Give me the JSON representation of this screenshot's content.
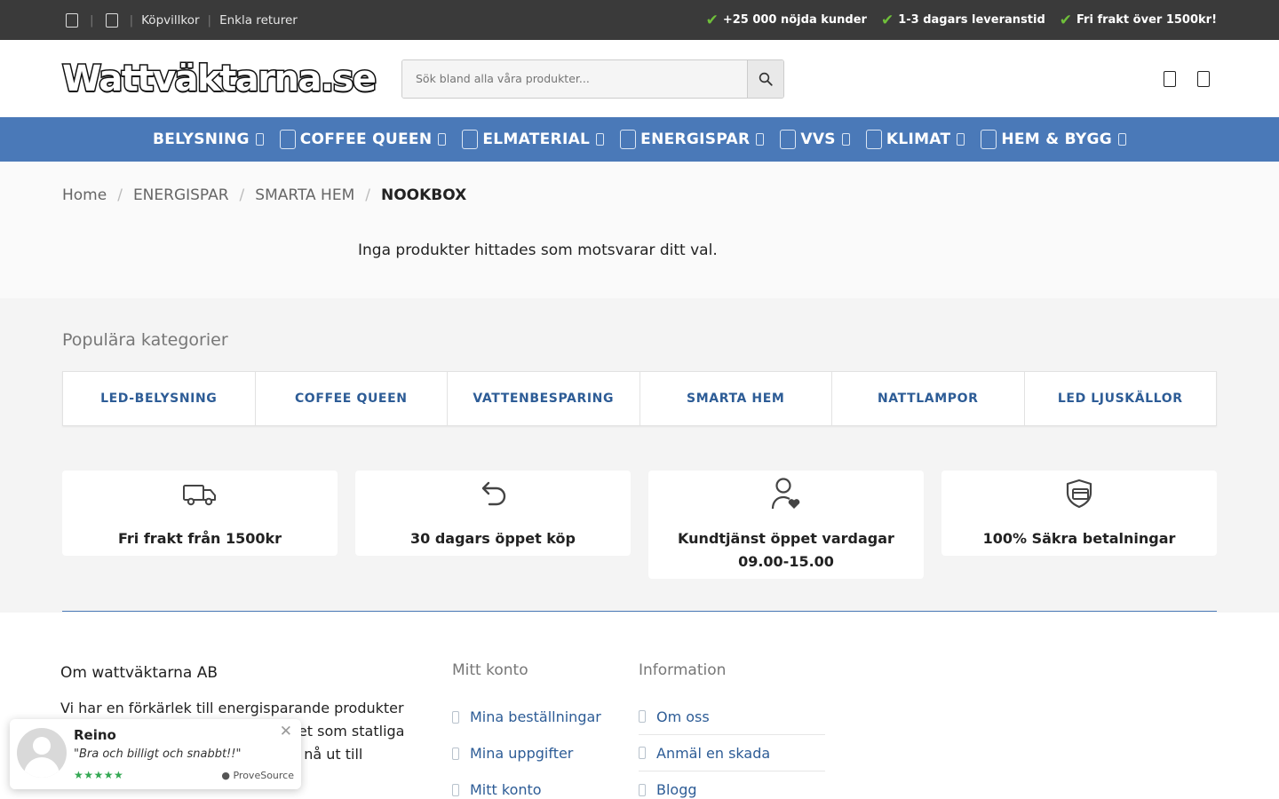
{
  "topbar": {
    "links": [
      "Köpvillkor",
      "Enkla returer"
    ],
    "usps": [
      "+25 000 nöjda kunder",
      "1-3 dagars leveranstid",
      "Fri frakt över 1500kr!"
    ]
  },
  "header": {
    "logo": "Wattväktarna.se",
    "search_placeholder": "Sök bland alla våra produkter..."
  },
  "nav": [
    {
      "label": "BELYSNING",
      "icon": "lamp-icon"
    },
    {
      "label": "COFFEE QUEEN",
      "icon": "coffee-machine-icon"
    },
    {
      "label": "ELMATERIAL",
      "icon": "plug-icon"
    },
    {
      "label": "ENERGISPAR",
      "icon": "energy-icon"
    },
    {
      "label": "VVS",
      "icon": "faucet-icon"
    },
    {
      "label": "KLIMAT",
      "icon": "radiator-icon"
    },
    {
      "label": "HEM & BYGG",
      "icon": "washing-machine-icon"
    }
  ],
  "breadcrumb": [
    "Home",
    "ENERGISPAR",
    "SMARTA HEM",
    "NOOKBOX"
  ],
  "notice": "Inga produkter hittades som motsvarar ditt val.",
  "popular": {
    "title": "Populära kategorier",
    "categories": [
      "LED-BELYSNING",
      "COFFEE QUEEN",
      "VATTENBESPARING",
      "SMARTA HEM",
      "NATTLAMPOR",
      "LED LJUSKÄLLOR"
    ]
  },
  "features": [
    {
      "text": "Fri frakt från 1500kr",
      "icon": "truck-icon"
    },
    {
      "text": "30 dagars öppet köp",
      "icon": "return-arrow-icon"
    },
    {
      "text": "Kundtjänst öppet vardagar 09.00-15.00",
      "icon": "user-heart-icon"
    },
    {
      "text": "100% Säkra betalningar",
      "icon": "secure-card-icon"
    }
  ],
  "footer": {
    "about_title": "Om wattväktarna AB",
    "about_text": "Vi har en förkärlek till energisparande produkter och att starta E-handel verksamhet som statliga fastighetsägare. Framförallt vill vi nå ut till",
    "konto_title": "Mitt konto",
    "konto_links": [
      "Mina beställningar",
      "Mina uppgifter",
      "Mitt konto"
    ],
    "info_title": "Information",
    "info_links": [
      "Om oss",
      "Anmäl en skada",
      "Blogg"
    ]
  },
  "popup": {
    "name": "Reino",
    "quote": "\"Bra och billigt och snabbt!!\"",
    "stars": "★★★★★",
    "source": "ProveSource"
  },
  "colors": {
    "nav": "#4a79b8",
    "topbar": "#3a3a3a",
    "link": "#2d5c96",
    "check": "#6fbf3a"
  }
}
